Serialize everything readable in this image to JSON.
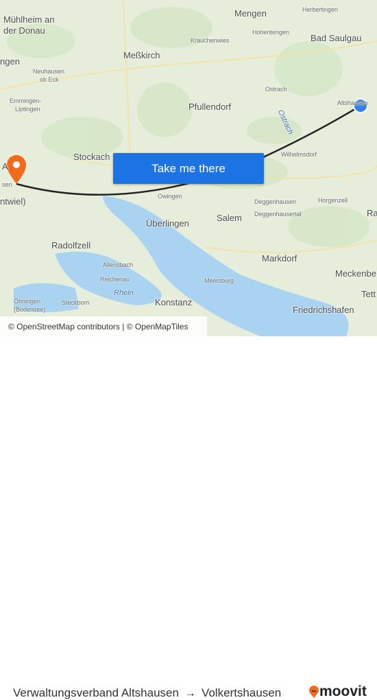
{
  "map": {
    "places": [
      {
        "name": "Mengen",
        "cls": "big"
      },
      {
        "name": "Herbertingen",
        "cls": "sm"
      },
      {
        "name": "Mühlheim an",
        "cls": "big"
      },
      {
        "name": "der Donau",
        "cls": "big"
      },
      {
        "name": "Hohentengen",
        "cls": "sm"
      },
      {
        "name": "Bad Saulgau",
        "cls": "big"
      },
      {
        "name": "Krauchenwies",
        "cls": "sm"
      },
      {
        "name": "Meßkirch",
        "cls": "big"
      },
      {
        "name": "ngen",
        "cls": "big"
      },
      {
        "name": "Neuhausen",
        "cls": "sm"
      },
      {
        "name": "ob Eck",
        "cls": "sm"
      },
      {
        "name": "Ostrach",
        "cls": "sm"
      },
      {
        "name": "Altshausen",
        "cls": "sm"
      },
      {
        "name": "Pfullendorf",
        "cls": "big"
      },
      {
        "name": "Emmingen-",
        "cls": "sm"
      },
      {
        "name": "Liptingen",
        "cls": "sm"
      },
      {
        "name": "Stockach",
        "cls": "big"
      },
      {
        "name": "Wilhelmsdorf",
        "cls": "sm"
      },
      {
        "name": "A",
        "cls": "big"
      },
      {
        "name": "sen",
        "cls": "sm"
      },
      {
        "name": "Owingen",
        "cls": "sm"
      },
      {
        "name": "Deggenhausen",
        "cls": "sm"
      },
      {
        "name": "Horgenzell",
        "cls": "sm"
      },
      {
        "name": "ntwiel)",
        "cls": "big"
      },
      {
        "name": "Salem",
        "cls": "big"
      },
      {
        "name": "Deggenhausertal",
        "cls": "sm"
      },
      {
        "name": "Überlingen",
        "cls": "big"
      },
      {
        "name": "Ra",
        "cls": "big"
      },
      {
        "name": "Radolfzell",
        "cls": "big"
      },
      {
        "name": "Markdorf",
        "cls": "big"
      },
      {
        "name": "Allensbach",
        "cls": "sm"
      },
      {
        "name": "Meersburg",
        "cls": "sm"
      },
      {
        "name": "Meckenbe",
        "cls": "big"
      },
      {
        "name": "Reichenau",
        "cls": "sm"
      },
      {
        "name": "Rhein",
        "cls": "water"
      },
      {
        "name": "Tett",
        "cls": "big"
      },
      {
        "name": "Konstanz",
        "cls": "big"
      },
      {
        "name": "Öhningen",
        "cls": "sm"
      },
      {
        "name": "(Bodensee)",
        "cls": "sm"
      },
      {
        "name": "Steckborn",
        "cls": "sm"
      },
      {
        "name": "Friedrichshafen",
        "cls": "big"
      },
      {
        "name": "Ostrach",
        "cls": "water"
      }
    ],
    "cta_label": "Take me there",
    "attribution": "© OpenStreetMap contributors | © OpenMapTiles",
    "colors": {
      "route": "#222222",
      "origin": "#2f7ff0",
      "destination": "#f26b1d",
      "button": "#1c74e4",
      "water": "#aad3f2"
    }
  },
  "footer": {
    "origin": "Verwaltungsverband Altshausen",
    "arrow": "→",
    "destination": "Volkertshausen",
    "brand": "moovit"
  }
}
